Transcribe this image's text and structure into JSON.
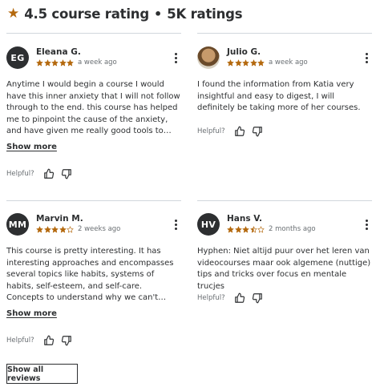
{
  "header": {
    "rating_text": "4.5 course rating",
    "separator": "•",
    "count_text": "5K ratings",
    "star_color": "#b4690e"
  },
  "helpful_label": "Helpful?",
  "show_more_label": "Show more",
  "show_all_label": "Show all reviews",
  "reviews": [
    {
      "initials": "EG",
      "name": "Eleana G.",
      "rating": 5,
      "date": "a week ago",
      "text": "Anytime I would begin a course I would have this inner anxiety that I will not follow through to the end. this course has helped me to pinpoint the cause of the anxiety, and have given me really good tools to combat it.Thank you.",
      "has_show_more": true
    },
    {
      "initials": "",
      "name": "Julio G.",
      "rating": 5,
      "date": "a week ago",
      "text": "I found the information from Katia very insightful and easy to digest, I will definitely be taking more of her courses.",
      "has_show_more": false
    },
    {
      "initials": "MM",
      "name": "Marvin M.",
      "rating": 4,
      "date": "2 weeks ago",
      "text": "This course is pretty interesting. It has interesting approaches and encompasses several topics like habits, systems of habits, self-esteem, and self-care. Concepts to understand why we can't concentrate on something.",
      "has_show_more": true
    },
    {
      "initials": "HV",
      "name": "Hans V.",
      "rating": 3.5,
      "date": "2 months ago",
      "text": "Hyphen: Niet altijd puur over het leren van videocourses maar ook algemene (nuttige) tips and tricks over focus en mentale trucjes",
      "has_show_more": false
    }
  ]
}
